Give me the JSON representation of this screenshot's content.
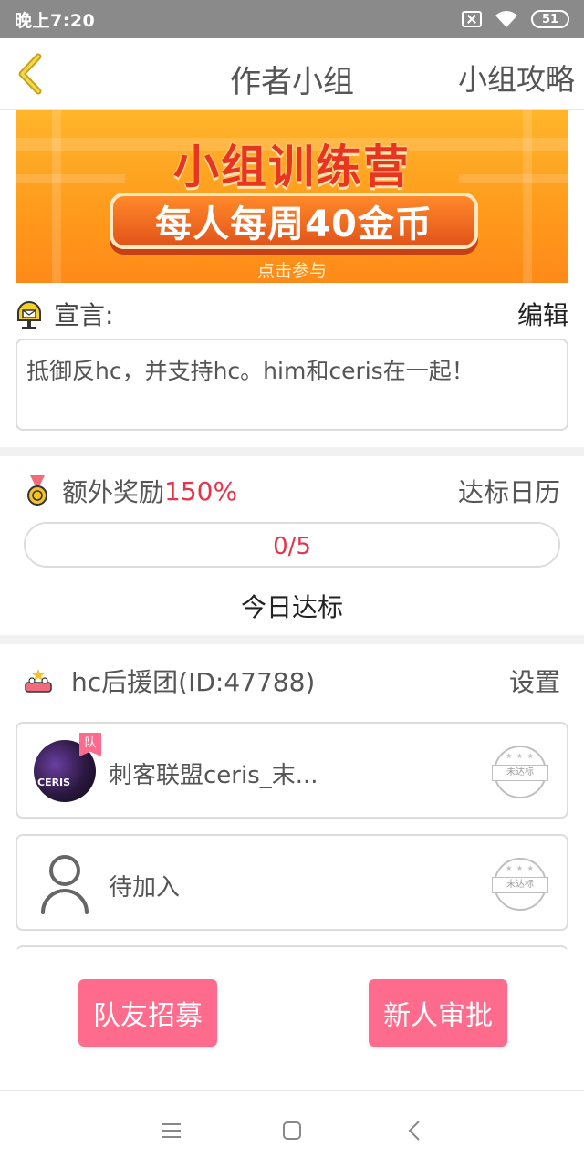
{
  "status_bar": {
    "time": "晚上7:20",
    "battery": "51",
    "icons": [
      "sim-off-icon",
      "wifi-icon",
      "battery-icon"
    ]
  },
  "nav": {
    "back_icon": "chevron-left-icon",
    "title": "作者小组",
    "right_link": "小组攻略"
  },
  "banner": {
    "title": "小组训练营",
    "subtitle": "每人每周40金币",
    "cta": "点击参与"
  },
  "manifesto": {
    "icon": "mailbox-icon",
    "label": "宣言:",
    "edit": "编辑",
    "text": "抵御反hc，并支持hc。him和ceris在一起！"
  },
  "bonus": {
    "icon": "medal-icon",
    "label": "额外奖励",
    "value": "150%",
    "calendar_link": "达标日历",
    "progress_text": "0/5",
    "progress_fraction": 0,
    "today_label": "今日达标"
  },
  "team": {
    "icon": "team-icon",
    "name": "hc后援团(ID:47788)",
    "settings": "设置",
    "members": [
      {
        "name": "刺客联盟ceris_末...",
        "badge": "队",
        "avatar_text": "CERIS",
        "stamp": "未达标"
      },
      {
        "name": "待加入",
        "stamp": "未达标"
      }
    ]
  },
  "actions": {
    "recruit": "队友招募",
    "approve": "新人审批"
  },
  "colors": {
    "accent_pink": "#ff6b8c",
    "highlight_red": "#e8334a",
    "banner_orange": "#ff9a1c"
  }
}
